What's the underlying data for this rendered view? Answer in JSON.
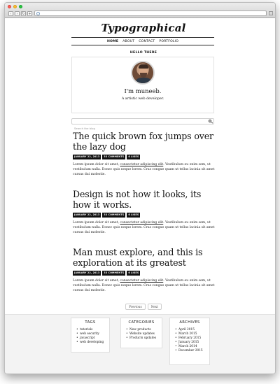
{
  "site": {
    "logo": "Typographical"
  },
  "nav": {
    "items": [
      "HOME",
      "ABOUT",
      "CONTACT",
      "PORTFOLIO"
    ]
  },
  "about": {
    "heading": "HELLO THERE",
    "name": "I'm muneeb.",
    "tagline": "A artistic web developer."
  },
  "search": {
    "placeholder": "Search the blog"
  },
  "posts": [
    {
      "title": "The quick brown fox jumps over the lazy dog",
      "date": "JANUARY 22, 2013",
      "comments": "33 COMMENTS",
      "likes": "6 LIKES",
      "excerpt_a": "Lorem ipsum dolor sit amet, ",
      "excerpt_link": "consectetur adipiscing elit",
      "excerpt_b": ". Vestibulum eu enim sem, ut vestibulum nulla. Donec quis neque lorem. Cras congue quam ut tellus lacinia sit amet cursus dui molestie."
    },
    {
      "title": "Design is not how it looks, its how it works.",
      "date": "JANUARY 22, 2013",
      "comments": "33 COMMENTS",
      "likes": "6 LIKES",
      "excerpt_a": "Lorem ipsum dolor sit amet, ",
      "excerpt_link": "consectetur adipiscing elit",
      "excerpt_b": ". Vestibulum eu enim sem, ut vestibulum nulla. Donec quis neque lorem. Cras congue quam ut tellus lacinia sit amet cursus dui molestie."
    },
    {
      "title": "Man must explore, and this is exploration at its greatest",
      "date": "JANUARY 22, 2013",
      "comments": "33 COMMENTS",
      "likes": "6 LIKES",
      "excerpt_a": "Lorem ipsum dolor sit amet, ",
      "excerpt_link": "consectetur adipiscing elit",
      "excerpt_b": ". Vestibulum eu enim sem, ut vestibulum nulla. Donec quis neque lorem. Cras congue quam ut tellus lacinia sit amet cursus dui molestie."
    }
  ],
  "pager": {
    "previous": "Previous",
    "next": "Next"
  },
  "widgets": {
    "tags": {
      "title": "TAGS",
      "items": [
        "tutorials",
        "web security",
        "javascript",
        "web developing"
      ]
    },
    "categories": {
      "title": "CATEGORIES",
      "items": [
        "New products",
        "Website updates",
        "Products updates"
      ]
    },
    "archives": {
      "title": "ARCHIVES",
      "items": [
        "April 2015",
        "March 2015",
        "February 2015",
        "January 2015",
        "March 2014",
        "December 2015"
      ]
    }
  }
}
